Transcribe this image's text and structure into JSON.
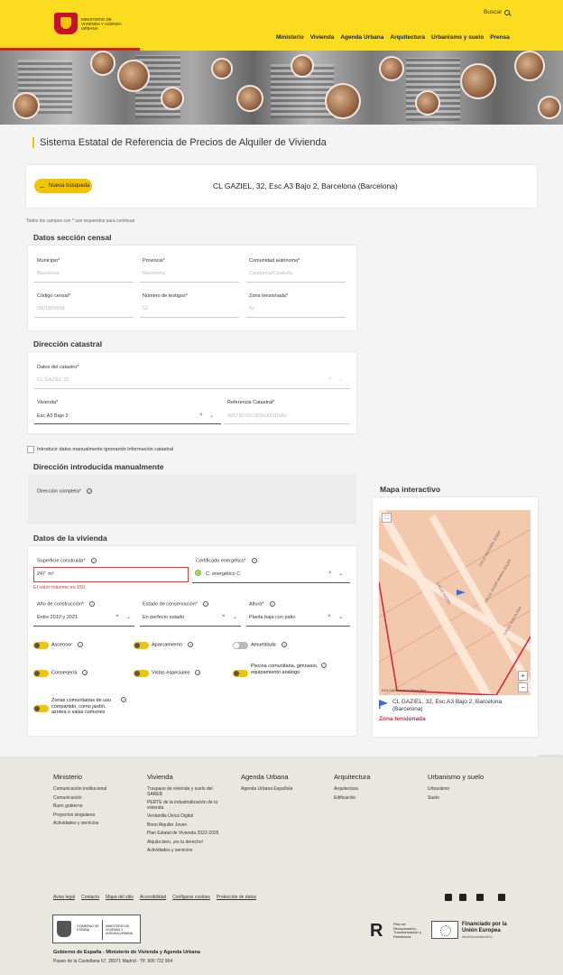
{
  "header": {
    "logo_text": "MINISTERIO DE VIVIENDA Y AGENDA URBANA",
    "search_label": "Buscar",
    "nav": [
      "Ministerio",
      "Vivienda",
      "Agenda Urbana",
      "Arquitectura",
      "Urbanismo y suelo",
      "Prensa"
    ]
  },
  "page_title": "Sistema Estatal de Referencia de Precios de Alquiler de Vivienda",
  "search_bar": {
    "new_search_label": "Nueva búsqueda",
    "address": "CL GAZIEL, 32, Esc.A3 Bajo 2, Barcelona (Barcelona)"
  },
  "required_note": "Todos los campos con * son requeridos para continuar",
  "census": {
    "title": "Datos sección censal",
    "municipio_label": "Municipio*",
    "municipio_value": "Barcelona",
    "provincia_label": "Provincia*",
    "provincia_value": "Barcelona",
    "comunidad_label": "Comunidad autónoma*",
    "comunidad_value": "Catalunya/Cataluña",
    "codigo_label": "Código censal*",
    "codigo_value": "0801905008",
    "testigos_label": "Número de testigos*",
    "testigos_value": "52",
    "zona_label": "Zona tensionada*",
    "zona_value": "Sí"
  },
  "catastral": {
    "title": "Dirección catastral",
    "datos_label": "Datos del catastro*",
    "datos_value": "CL GAZIEL 32",
    "vivienda_label": "Vivienda*",
    "vivienda_value": "Esc.A3 Bajo 2",
    "ref_label": "Referencia Catastral*",
    "ref_value": "9957301DF2895H0001MU"
  },
  "manual_checkbox_label": "Introducir datos manualmente ignorando información catastral",
  "manual": {
    "title": "Dirección introducida manualmente",
    "direccion_label": "Dirección completa*"
  },
  "vivienda": {
    "title": "Datos de la vivienda",
    "superficie_label": "Superficie construida*",
    "superficie_value": "247",
    "superficie_unit": "m²",
    "superficie_error": "El valor máximo es 150",
    "cert_label": "Certificado energético*",
    "cert_value": "C. energético C",
    "cert_badge": "C",
    "anio_label": "Año de construcción*",
    "anio_value": "Entre 2010 y 2021",
    "estado_label": "Estado de conservación*",
    "estado_value": "En perfecto estado",
    "altura_label": "Altura*",
    "altura_value": "Planta baja con patio",
    "toggles": [
      {
        "label": "Ascensor",
        "on": true
      },
      {
        "label": "Aparcamiento",
        "on": true
      },
      {
        "label": "Amueblada",
        "on": false
      },
      {
        "label": "Conserjería",
        "on": true
      },
      {
        "label": "Vistas especiales",
        "on": true
      },
      {
        "label": "Piscina comunitaria, gimnasio, equipamiento análogo",
        "on": true
      },
      {
        "label": "Zonas comunitarias de uso compartido, como jardín, azotea o salas comunes",
        "on": true
      }
    ]
  },
  "map": {
    "title": "Mapa interactivo",
    "streets": [
      "CALLE MOSSEN JOSEP",
      "CALLE JOSEP MARIA SOLER",
      "CALLE GAZIEL",
      "CALLE SANTA ANA"
    ],
    "attribution": "IGN  Cartociudad  Mapa libre",
    "address": "CL GAZIEL, 32, Esc.A3 Bajo 2, Barcelona (Barcelona)",
    "zona": "Zona tensionada",
    "zoom_in": "+",
    "zoom_out": "−"
  },
  "footer": {
    "columns": [
      {
        "title": "Ministerio",
        "items": [
          "Comunicación institucional",
          "Comunicación",
          "Buen gobierno",
          "Proyectos singulares",
          "Actividades y servicios"
        ]
      },
      {
        "title": "Vivienda",
        "items": [
          "Traspaso de vivienda y suelo del SAREB",
          "PERTE de la industrialización de la vivienda",
          "Ventanilla Única Digital",
          "Bono Alquiler Joven",
          "Plan Estatal de Vivienda 2022-2025",
          "Alquila bien, ¡es tu derecho!",
          "Actividades y servicios"
        ]
      },
      {
        "title": "Agenda Urbana",
        "items": [
          "Agenda Urbana Española"
        ]
      },
      {
        "title": "Arquitectura",
        "items": [
          "Arquitectura",
          "Edificación"
        ]
      },
      {
        "title": "Urbanismo y suelo",
        "items": [
          "Urbanismo",
          "Suelo"
        ]
      }
    ],
    "links": [
      "Aviso legal",
      "Contacto",
      "Mapa del sitio",
      "Accesibilidad",
      "Configurar cookies",
      "Protección de datos"
    ],
    "gob_left": "GOBIERNO DE ESPAÑA",
    "gob_right": "MINISTERIO DE VIVIENDA Y AGENDA URBANA",
    "org": "Gobierno de España - Ministerio de Vivienda y Agenda Urbana",
    "address": "Paseo de la Castellana 67, 28071 Madrid - Tlf. 900 732 904",
    "plan_text": "Plan de Recuperación, Transformación y Resiliencia",
    "eu_text": "Financiado por la Unión Europea",
    "eu_sub": "NextGenerationEU"
  }
}
